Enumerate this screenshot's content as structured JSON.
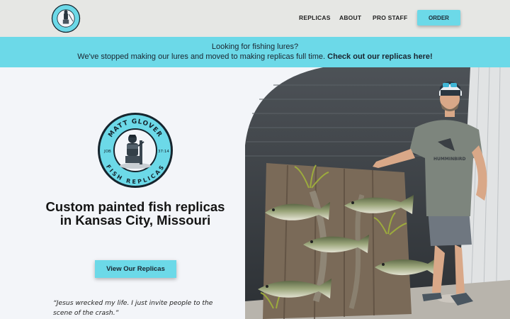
{
  "brand": {
    "logo_alt": "Matt Glover Fish Replicas logo",
    "logo_top": "MATT GLOVER",
    "logo_bottom": "FISH REPLICAS",
    "logo_left": "JOB",
    "logo_right": "37:14"
  },
  "nav": {
    "items": [
      {
        "label": "REPLICAS"
      },
      {
        "label": "ABOUT"
      },
      {
        "label": "PRO STAFF"
      }
    ],
    "order_label": "ORDER"
  },
  "banner": {
    "line1": "Looking for fishing lures?",
    "line2": "We've stopped making our lures and moved to making replicas full time.",
    "link": "Check out our replicas here!"
  },
  "hero": {
    "title": "Custom painted fish replicas in Kansas City, Missouri",
    "cta_label": "View Our Replicas",
    "quote": "“Jesus wrecked my life. I just invite people to the scene of the crash.”",
    "shirt_brand": "HUMMINBIRD"
  },
  "colors": {
    "accent": "#6cd9e8",
    "header_bg": "#e6e7e4",
    "page_bg": "#f3f5f9",
    "text": "#141414"
  },
  "icons": {
    "logo": "fisherman-badge-icon"
  }
}
